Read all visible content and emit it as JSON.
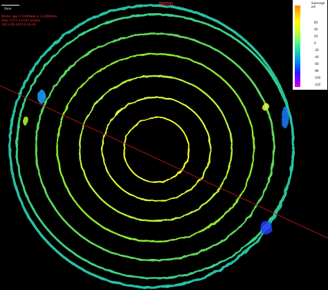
{
  "overlay": {
    "scale_label": "2mm",
    "meta_lines": [
      "Motor spe 5.5200mm x 3.2000mm",
      "Size 1273 x 1187 points",
      "2021-05-28T10:33:41"
    ],
    "top_label": "temp"
  },
  "legend": {
    "title_line1": "Subrange",
    "title_line2": "µm",
    "ticks": [
      "60",
      "40",
      "20",
      "0",
      "-20",
      "-40",
      "-60",
      "-80",
      "-100",
      "-120"
    ]
  },
  "colors": {
    "background": "#000000",
    "inner_ring": "#f5ff2a",
    "mid_ring": "#8ee832",
    "outer_ring": "#27c0a2",
    "line": "#c01818"
  }
}
